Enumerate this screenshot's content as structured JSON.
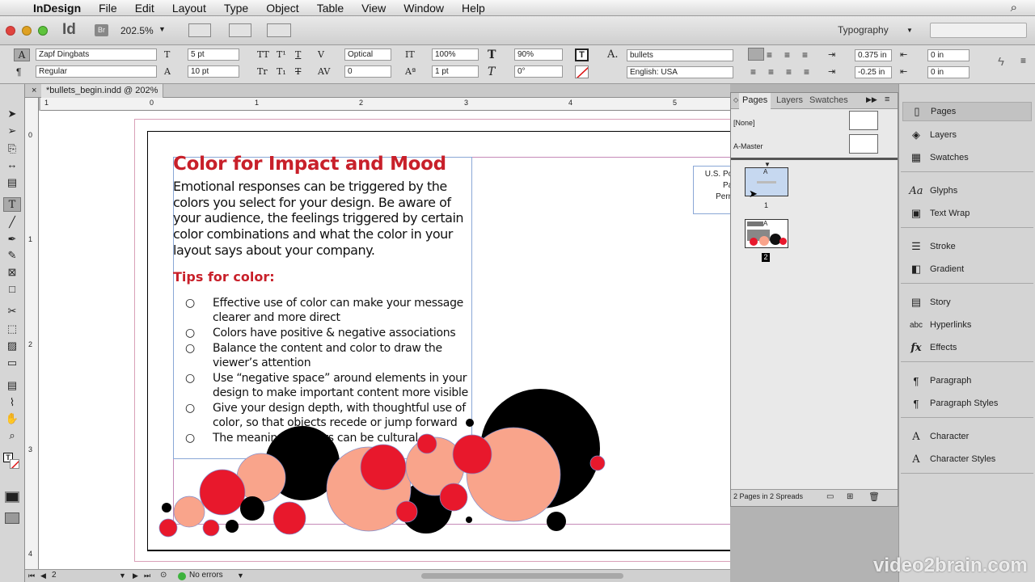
{
  "menubar": {
    "app": "InDesign",
    "items": [
      "File",
      "Edit",
      "Layout",
      "Type",
      "Object",
      "Table",
      "View",
      "Window",
      "Help"
    ]
  },
  "appbar": {
    "app_logo": "Id",
    "bridge": "Br",
    "zoom": "202.5%",
    "workspace": "Typography"
  },
  "control": {
    "font_family": "Zapf Dingbats",
    "font_style": "Regular",
    "font_size": "5 pt",
    "leading": "10 pt",
    "tracking_kind": "Optical",
    "tracking": "0",
    "vscale": "100%",
    "baseline": "1 pt",
    "hscale": "90%",
    "skew": "0°",
    "para_style": "bullets",
    "language": "English: USA",
    "left_indent": "0.375 in",
    "first_indent": "-0.25 in",
    "right_indent": "0 in",
    "last_indent": "0 in"
  },
  "document": {
    "tab_title": "*bullets_begin.indd @ 202%",
    "ruler_h": [
      "1",
      "0",
      "1",
      "2",
      "3",
      "4",
      "5"
    ],
    "ruler_v": [
      "0",
      "1",
      "2",
      "3",
      "4"
    ]
  },
  "content": {
    "headline": "Color for Impact and Mood",
    "intro": "Emotional responses can be triggered by the colors you select for your design. Be aware of your audience, the feelings triggered by certain color combinations and what the color in your layout says about your company.",
    "tips_heading": "Tips for color:",
    "bullets": [
      "Effective use of color can make your message clearer and more direct",
      "Colors have positive & negative associations",
      "Balance the content and color to draw the viewer’s attention",
      "Use “negative space” around elements in your design to make important content more visible",
      "Give your design depth, with thoughtful use of color, so that objects recede or jump forward",
      "The meaning of colors can be cultural"
    ],
    "bullet_glyph": "○",
    "postage": [
      "U.S. Post",
      "Paid",
      "Permit"
    ],
    "colors": {
      "red": "#e8182c",
      "salmon": "#f9a48b",
      "black": "#000000",
      "headline": "#c8202a"
    }
  },
  "pages_panel": {
    "tabs": [
      "Pages",
      "Layers",
      "Swatches"
    ],
    "masters": [
      "[None]",
      "A-Master"
    ],
    "page_labels": [
      "1",
      "2"
    ],
    "master_letter": "A",
    "footer": "2 Pages in 2 Spreads"
  },
  "panel_strip": {
    "groups": [
      [
        "Pages",
        "Layers",
        "Swatches"
      ],
      [
        "Glyphs",
        "Text Wrap"
      ],
      [
        "Stroke",
        "Gradient"
      ],
      [
        "Story",
        "Hyperlinks",
        "Effects"
      ],
      [
        "Paragraph",
        "Paragraph Styles"
      ],
      [
        "Character",
        "Character Styles"
      ]
    ],
    "labels": {
      "pages": "Pages",
      "layers": "Layers",
      "swatches": "Swatches",
      "glyphs": "Glyphs",
      "textwrap": "Text Wrap",
      "stroke": "Stroke",
      "gradient": "Gradient",
      "story": "Story",
      "hyperlinks": "Hyperlinks",
      "effects": "Effects",
      "paragraph": "Paragraph",
      "parastyles": "Paragraph Styles",
      "character": "Character",
      "charstyles": "Character Styles"
    }
  },
  "status": {
    "page": "2",
    "errors": "No errors"
  },
  "watermark": "video2brain.com"
}
